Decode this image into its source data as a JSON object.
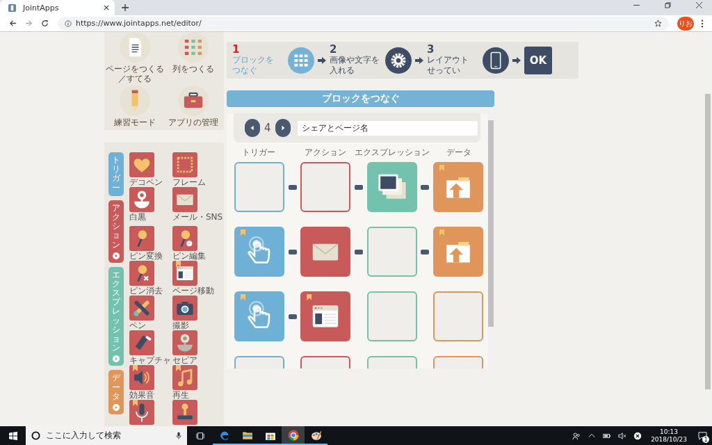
{
  "browser": {
    "tab_title": "JointApps",
    "url": "https://www.jointapps.net/editor/",
    "profile": "りお"
  },
  "tools": [
    {
      "label_lines": [
        "ページをつくる",
        "／すてる"
      ],
      "kind": "document"
    },
    {
      "label_lines": [
        "列をつくる"
      ],
      "kind": "beads"
    },
    {
      "label_lines": [
        "練習モード"
      ],
      "kind": "pencil"
    },
    {
      "label_lines": [
        "アプリの管理"
      ],
      "kind": "toolbox"
    }
  ],
  "categories": [
    {
      "label": "トリガー",
      "color": "#6fb1d6",
      "expandable": false
    },
    {
      "label": "アクション",
      "color": "#c95a5a",
      "expandable": true
    },
    {
      "label": "エクスプレッション",
      "color": "#72c2ad",
      "expandable": true
    },
    {
      "label": "データ",
      "color": "#e0955a",
      "expandable": true
    }
  ],
  "palette_groups": [
    {
      "blocks": [
        {
          "label": "デコペン",
          "kind": "heart",
          "bookmarked": false
        },
        {
          "label": "フレーム",
          "kind": "frame",
          "bookmarked": false
        },
        {
          "label": "白黒",
          "kind": "flower",
          "bookmarked": false
        },
        {
          "label": "メール・SNS",
          "kind": "mail",
          "bookmarked": false
        }
      ]
    },
    {
      "blocks": [
        {
          "label": "ピン変換",
          "kind": "pin",
          "bookmarked": false
        },
        {
          "label": "ピン編集",
          "kind": "pin-comment",
          "bookmarked": false
        },
        {
          "label": "ピン消去",
          "kind": "pin-x",
          "bookmarked": false
        },
        {
          "label": "ページ移動",
          "kind": "window",
          "bookmarked": true
        },
        {
          "label": "ペン",
          "kind": "brush",
          "bookmarked": false
        },
        {
          "label": "撮影",
          "kind": "camera",
          "bookmarked": false
        },
        {
          "label": "キャプチャ",
          "kind": "capture",
          "bookmarked": false
        },
        {
          "label": "セピア",
          "kind": "flower-gray",
          "bookmarked": false
        },
        {
          "label": "効果音",
          "kind": "speaker",
          "bookmarked": true
        },
        {
          "label": "再生",
          "kind": "note",
          "bookmarked": true
        },
        {
          "kind": "mic",
          "bookmarked": true
        },
        {
          "kind": "stamp",
          "bookmarked": false
        }
      ]
    }
  ],
  "steps": [
    {
      "number": "1",
      "label_lines": [
        "ブロックを",
        "つなぐ"
      ],
      "kind": "blocks",
      "selected": true
    },
    {
      "number": "2",
      "label_lines": [
        "画像や文字を",
        "入れる"
      ],
      "kind": "gear",
      "selected": false
    },
    {
      "number": "3",
      "label_lines": [
        "レイアウト",
        "せってい"
      ],
      "kind": "phone",
      "selected": false
    }
  ],
  "ok_button": "OK",
  "section_title": "ブロックをつなぐ",
  "editor": {
    "page_number": "4",
    "page_name": "シェアとページ名",
    "columns": [
      {
        "label": "トリガー",
        "color": "#6fb1d6"
      },
      {
        "label": "アクション",
        "color": "#c95a5a"
      },
      {
        "label": "エクスプレッション",
        "color": "#72c2ad"
      },
      {
        "label": "データ",
        "color": "#e0955a"
      }
    ],
    "rows": [
      {
        "cells": [
          {
            "kind": "empty",
            "bookmarked": false
          },
          {
            "kind": "empty",
            "bookmarked": false
          },
          {
            "kind": "images",
            "bookmarked": false
          },
          {
            "kind": "folder",
            "bookmarked": true
          }
        ],
        "links": [
          true,
          true,
          true
        ]
      },
      {
        "cells": [
          {
            "kind": "touch",
            "bookmarked": true
          },
          {
            "kind": "mail",
            "bookmarked": false
          },
          {
            "kind": "empty",
            "bookmarked": false
          },
          {
            "kind": "folder",
            "bookmarked": true
          }
        ],
        "links": [
          true,
          true,
          true
        ]
      },
      {
        "cells": [
          {
            "kind": "touch",
            "bookmarked": true
          },
          {
            "kind": "window",
            "bookmarked": true
          },
          {
            "kind": "empty",
            "bookmarked": false
          },
          {
            "kind": "empty",
            "bookmarked": false
          }
        ],
        "links": [
          true,
          false,
          false
        ]
      },
      {
        "cells": [
          {
            "kind": "empty",
            "bookmarked": false
          },
          {
            "kind": "empty",
            "bookmarked": false
          },
          {
            "kind": "empty",
            "bookmarked": false
          },
          {
            "kind": "empty",
            "bookmarked": false
          }
        ],
        "links": [
          false,
          false,
          false
        ]
      }
    ]
  },
  "taskbar": {
    "search_placeholder": "ここに入力して検索",
    "time": "10:13",
    "date": "2018/10/23",
    "notifications": "1"
  }
}
